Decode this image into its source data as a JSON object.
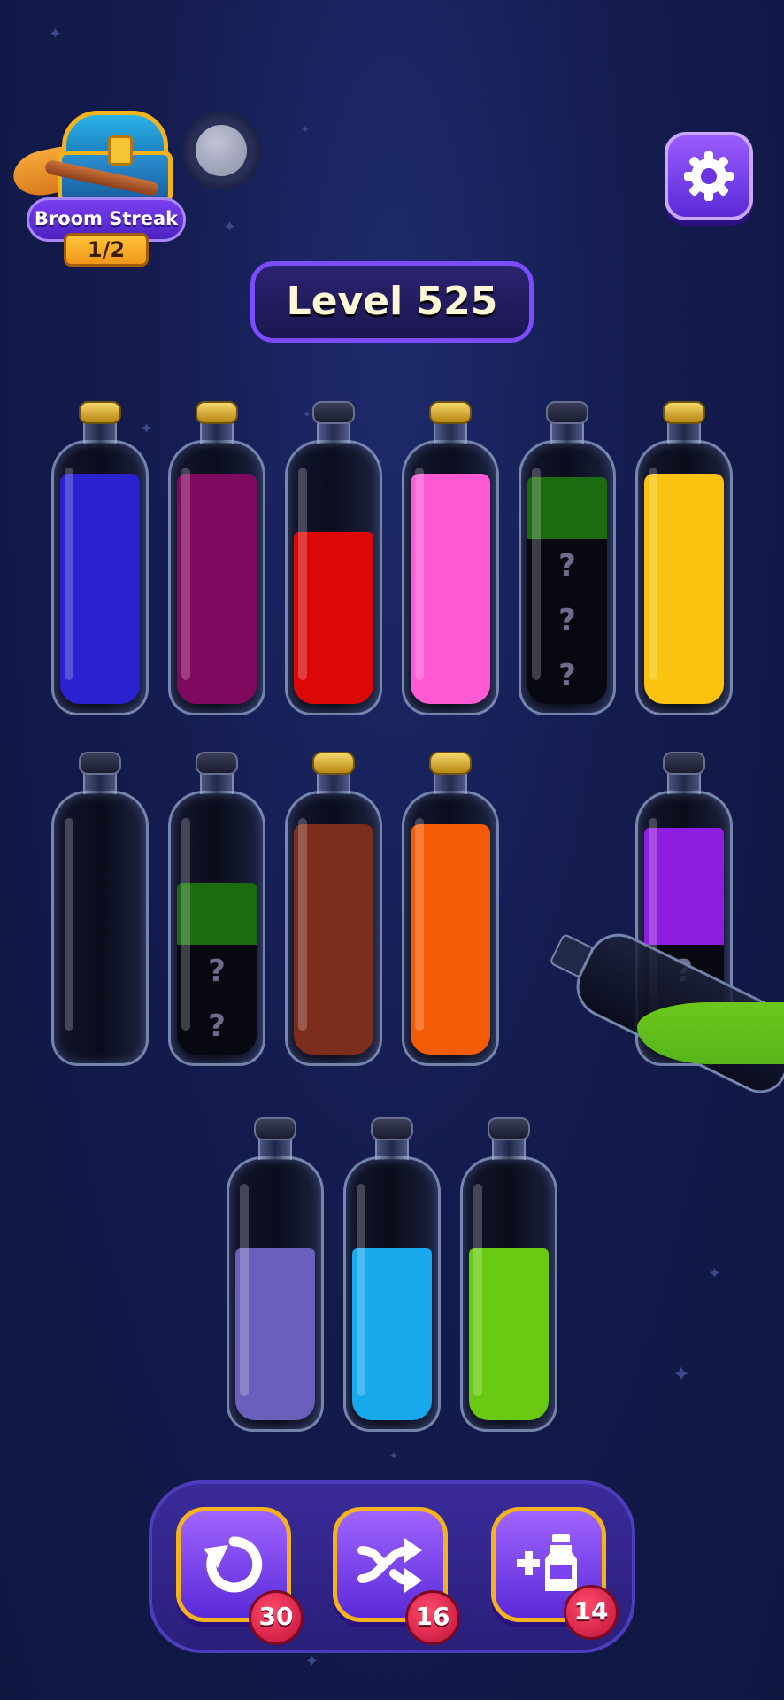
{
  "streak": {
    "title": "Broom Streak",
    "progress": "1/2"
  },
  "level": {
    "label": "Level 525"
  },
  "colors": {
    "blue": "#2a22c8",
    "magenta": "#7a0a5c",
    "red": "#d40a0a",
    "pink": "#ff5cd0",
    "dark_green": "#1f6a14",
    "yellow": "#f6c318",
    "brown": "#7a2e1e",
    "orange": "#ee5c0c",
    "purple": "#8a1fd8",
    "lavender": "#6a60b8",
    "cyan": "#1ea7e8",
    "lime": "#6cc71a",
    "mystery": "#080910"
  },
  "board": {
    "mystery_mark": "?",
    "rows": [
      [
        {
          "capped": true,
          "segments": [
            {
              "color": "blue",
              "units": 4
            }
          ]
        },
        {
          "capped": true,
          "segments": [
            {
              "color": "magenta",
              "units": 4
            }
          ]
        },
        {
          "capped": false,
          "segments": [
            {
              "color": "red",
              "units": 3
            }
          ]
        },
        {
          "capped": true,
          "segments": [
            {
              "color": "pink",
              "units": 4
            }
          ]
        },
        {
          "capped": false,
          "segments": [
            {
              "color": "mystery",
              "units": 3
            },
            {
              "color": "dark_green",
              "units": 1
            }
          ]
        },
        {
          "capped": true,
          "segments": [
            {
              "color": "yellow",
              "units": 4
            }
          ]
        }
      ],
      [
        {
          "capped": false,
          "segments": []
        },
        {
          "capped": false,
          "segments": [
            {
              "color": "mystery",
              "units": 2
            },
            {
              "color": "dark_green",
              "units": 1
            }
          ]
        },
        {
          "capped": true,
          "segments": [
            {
              "color": "brown",
              "units": 4
            }
          ]
        },
        {
          "capped": true,
          "segments": [
            {
              "color": "orange",
              "units": 4
            }
          ]
        },
        null,
        {
          "capped": false,
          "segments": [
            {
              "color": "mystery",
              "units": 2
            },
            {
              "color": "purple",
              "units": 2
            }
          ]
        }
      ],
      [
        {
          "capped": false,
          "segments": [
            {
              "color": "lavender",
              "units": 3
            }
          ]
        },
        {
          "capped": false,
          "segments": [
            {
              "color": "cyan",
              "units": 3
            }
          ]
        },
        {
          "capped": false,
          "segments": [
            {
              "color": "lime",
              "units": 3
            }
          ]
        }
      ]
    ],
    "pouring_bottle": {
      "liquid": "lime"
    }
  },
  "toolbar": {
    "undo": {
      "icon": "undo-icon",
      "count": "30"
    },
    "shuffle": {
      "icon": "shuffle-icon",
      "count": "16"
    },
    "add_bottle": {
      "icon": "add-bottle-icon",
      "count": "14"
    }
  }
}
